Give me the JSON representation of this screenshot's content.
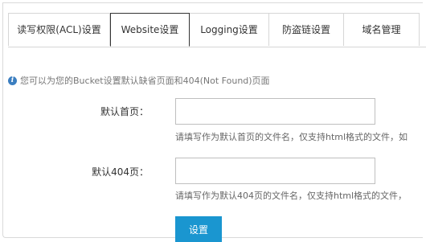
{
  "tabs": [
    {
      "label": "读写权限(ACL)设置",
      "active": false
    },
    {
      "label": "Website设置",
      "active": true
    },
    {
      "label": "Logging设置",
      "active": false
    },
    {
      "label": "防盗链设置",
      "active": false
    },
    {
      "label": "域名管理",
      "active": false
    }
  ],
  "tip": "您可以为您的Bucket设置默认缺省页面和404(Not Found)页面",
  "form": {
    "index_label": "默认首页：",
    "index_value": "",
    "index_help": "请填写作为默认首页的文件名，仅支持html格式的文件，如",
    "notfound_label": "默认404页：",
    "notfound_value": "",
    "notfound_help": "请填写作为默认404页的文件名，仅支持html格式的文件，",
    "submit_label": "设置"
  }
}
